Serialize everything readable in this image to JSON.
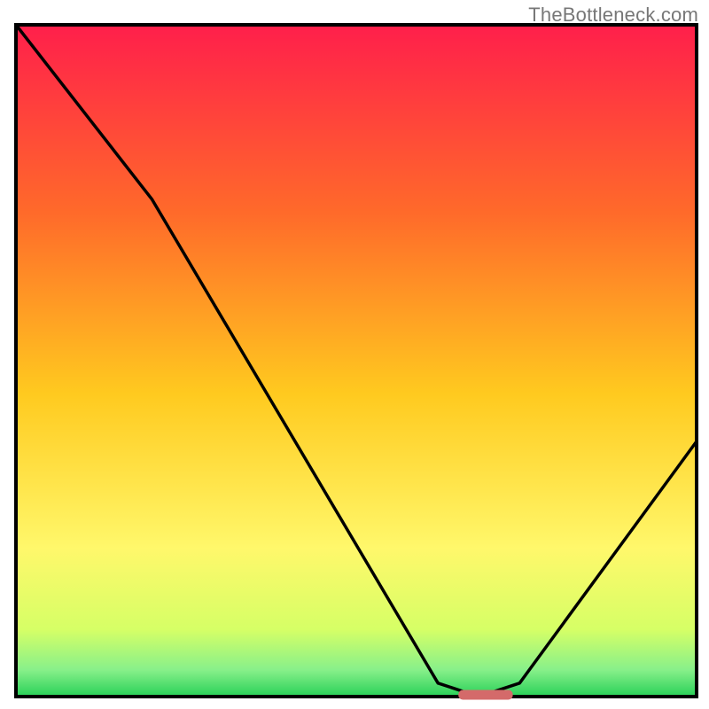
{
  "watermark": {
    "text": "TheBottleneck.com"
  },
  "chart_data": {
    "type": "line",
    "title": "",
    "xlabel": "",
    "ylabel": "",
    "xlim": [
      0,
      100
    ],
    "ylim": [
      0,
      100
    ],
    "x": [
      0,
      20,
      62,
      68,
      74,
      100
    ],
    "y": [
      100,
      74,
      2,
      0,
      2,
      38
    ],
    "marker": {
      "x_start": 65,
      "x_end": 73,
      "y": 0
    },
    "gradient_stops": [
      {
        "offset": 0.0,
        "color": "#ff1f4b"
      },
      {
        "offset": 0.28,
        "color": "#ff6a2a"
      },
      {
        "offset": 0.55,
        "color": "#ffca1f"
      },
      {
        "offset": 0.78,
        "color": "#fff86b"
      },
      {
        "offset": 0.9,
        "color": "#d6ff66"
      },
      {
        "offset": 0.96,
        "color": "#88f08a"
      },
      {
        "offset": 1.0,
        "color": "#28d058"
      }
    ],
    "frame_color": "#000000",
    "line_color": "#000000",
    "marker_color": "#d46a6a"
  }
}
